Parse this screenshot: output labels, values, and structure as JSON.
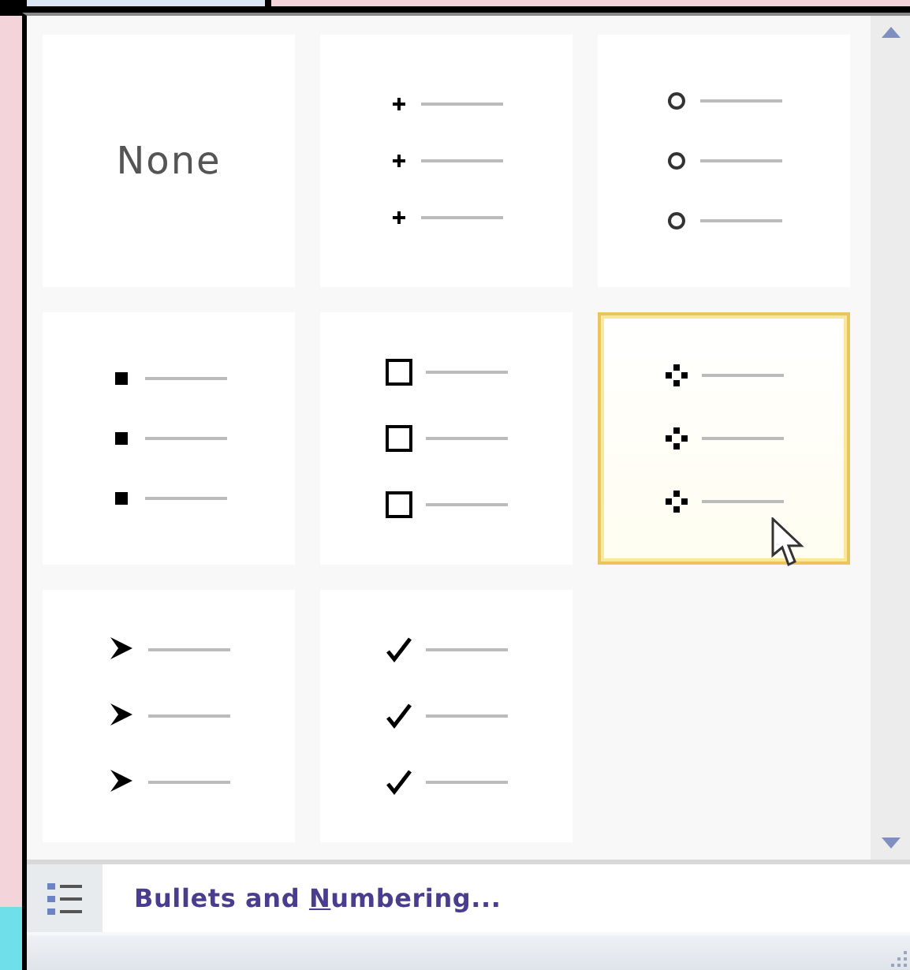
{
  "bullet_library": [
    {
      "kind": "none",
      "label": "None",
      "selected": false
    },
    {
      "kind": "star",
      "selected": false
    },
    {
      "kind": "circle",
      "selected": false
    },
    {
      "kind": "square",
      "selected": false
    },
    {
      "kind": "box",
      "selected": false
    },
    {
      "kind": "diamond",
      "selected": true
    },
    {
      "kind": "arrowhead",
      "selected": false
    },
    {
      "kind": "check",
      "selected": false
    }
  ],
  "footer": {
    "label_before": "Bullets and ",
    "access_key": "N",
    "label_after": "umbering..."
  }
}
